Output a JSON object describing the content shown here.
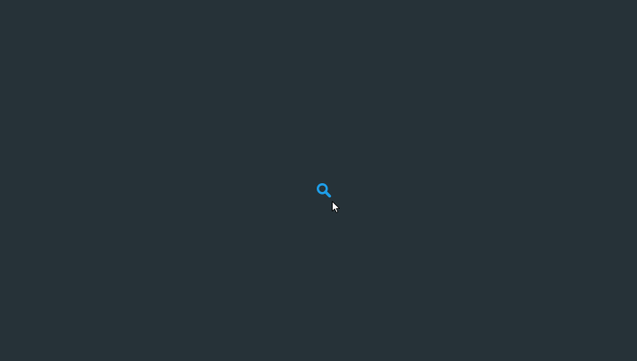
{
  "colors": {
    "background": "#263238",
    "accent": "#1e9ee8",
    "cursor_fill": "#ffffff",
    "cursor_stroke": "#000000"
  },
  "search": {
    "icon": "search-icon"
  },
  "cursor": {
    "icon": "mouse-pointer-icon"
  }
}
